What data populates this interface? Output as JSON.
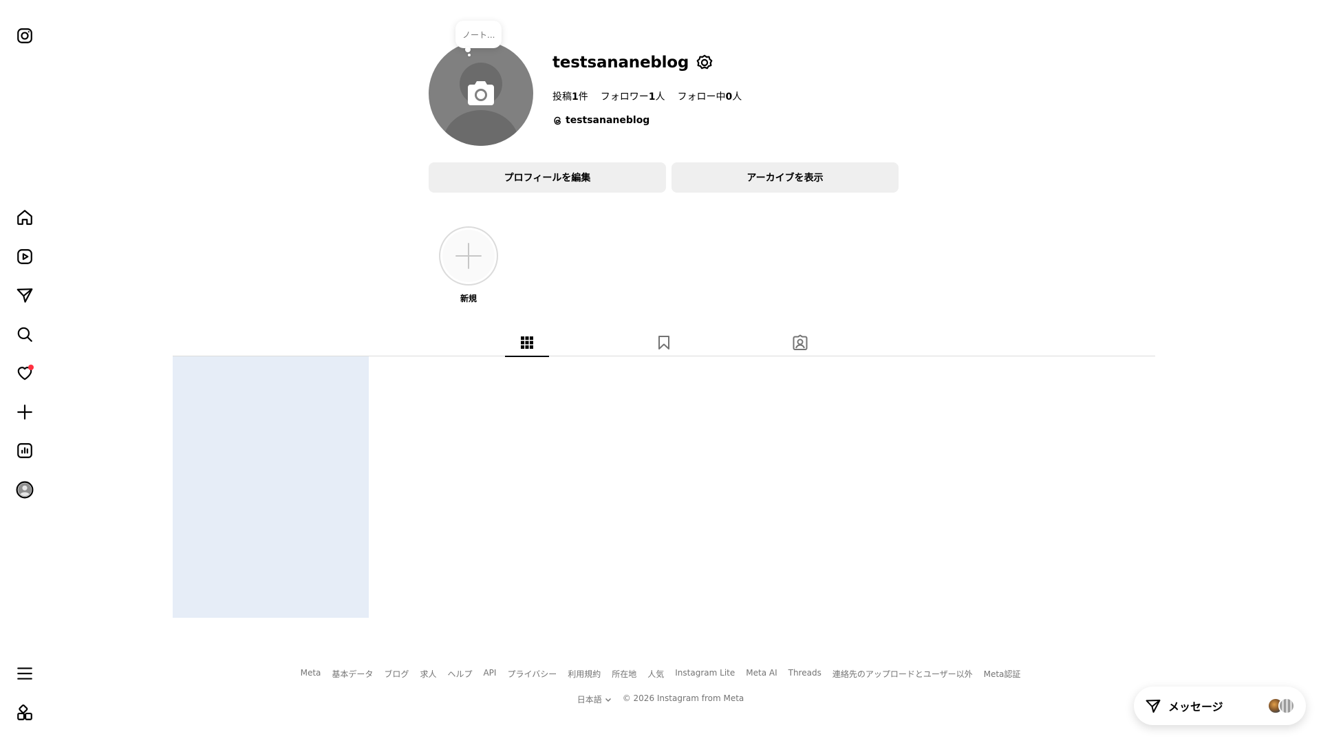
{
  "profile": {
    "username": "testsananeblog",
    "note_placeholder": "ノート...",
    "stats": {
      "posts_label": "投稿",
      "posts_count": "1",
      "posts_unit": "件",
      "followers_label": "フォロワー",
      "followers_count": "1",
      "followers_unit": "人",
      "following_label": "フォロー中",
      "following_count": "0",
      "following_unit": "人"
    },
    "threads_handle": "testsananeblog"
  },
  "actions": {
    "edit_profile": "プロフィールを編集",
    "view_archive": "アーカイブを表示"
  },
  "highlights": {
    "new_label": "新規"
  },
  "nav": {
    "icons": [
      "instagram-logo",
      "home",
      "reels",
      "messages",
      "search",
      "notifications",
      "create",
      "dashboard",
      "profile",
      "more",
      "also-from-meta"
    ]
  },
  "tabs": [
    "posts-grid",
    "saved",
    "tagged"
  ],
  "footer": {
    "links": [
      "Meta",
      "基本データ",
      "ブログ",
      "求人",
      "ヘルプ",
      "API",
      "プライバシー",
      "利用規約",
      "所在地",
      "人気",
      "Instagram Lite",
      "Meta AI",
      "Threads",
      "連絡先のアップロードとユーザー以外",
      "Meta認証"
    ],
    "language": "日本語",
    "copyright": "© 2026 Instagram from Meta"
  },
  "messages": {
    "label": "メッセージ"
  },
  "colors": {
    "button_bg": "#efefef",
    "notification_dot": "#ff3040",
    "post_placeholder": "#e6edf7",
    "muted_text": "#737373"
  }
}
